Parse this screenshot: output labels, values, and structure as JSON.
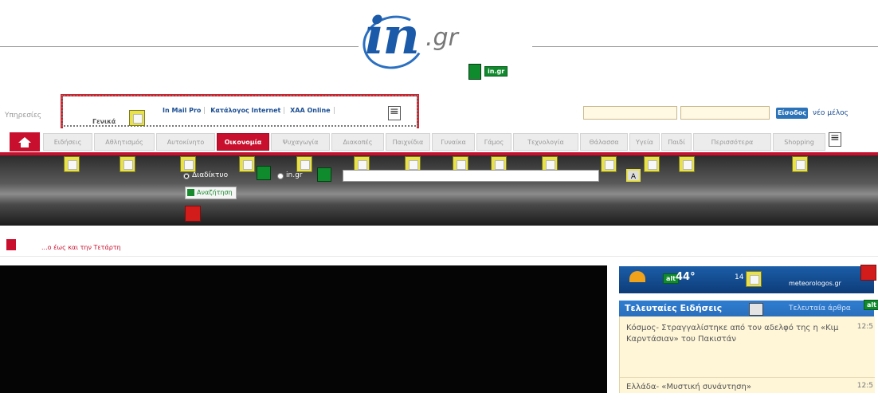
{
  "logo": {
    "main": "in",
    "suffix": ".gr"
  },
  "green_tags": {
    "logo_tag": "in.gr",
    "weather_tag": "alt",
    "news_tag": "alt"
  },
  "services_label": "Υπηρεσίες",
  "top_links": [
    "In Mail Pro",
    "Κατάλογος Internet",
    "XAA Online"
  ],
  "search_overlay_label": "Γενικά",
  "login": {
    "button": "Είσοδος",
    "new_member": "νέο μέλος"
  },
  "nav_tabs": [
    "Ειδήσεις",
    "Αθλητισμός",
    "Αυτοκίνητο",
    "Οικονομία",
    "Ψυχαγωγία",
    "Διακοπές",
    "Παιχνίδια",
    "Γυναίκα",
    "Γάμος",
    "Τεχνολογία",
    "Θάλασσα",
    "Υγεία",
    "Παιδί",
    "Περισσότερα",
    "Shopping"
  ],
  "active_tab": "Οικονομία",
  "more_tab_suffix": "▾",
  "search": {
    "radio_web": "Διαδίκτυο",
    "radio_in": "in.gr",
    "button": "Αναζήτηση"
  },
  "breaking": "...ο έως και την Τετάρτη",
  "weather": {
    "temp": "44°",
    "small": "14",
    "site": "meteorologos.gr"
  },
  "news": {
    "tab_latest": "Τελευταίες Ειδήσεις",
    "tab_articles": "Τελευταία άρθρα",
    "items": [
      {
        "text": "Κόσμος- Στραγγαλίστηκε από τον αδελφό της η «Κιμ Καρντάσιαν» του Πακιστάν",
        "time": "12:5"
      },
      {
        "text": "Ελλάδα- «Μυστική συνάντηση»",
        "time": "12:5"
      }
    ]
  },
  "colors": {
    "brand_red": "#c8102e",
    "brand_blue": "#1a5aa8",
    "highlight_red": "#e01c29"
  }
}
